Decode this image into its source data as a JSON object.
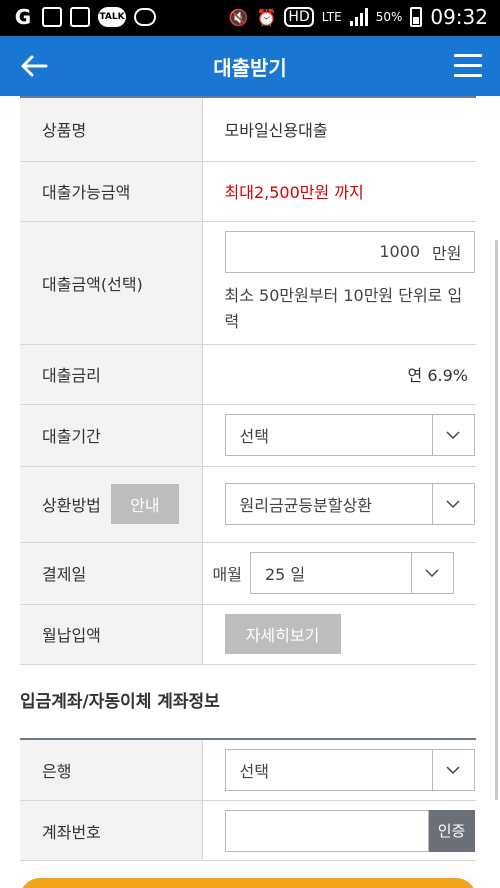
{
  "status": {
    "battery": "50%",
    "time": "09:32",
    "lte": "LTE",
    "hd": "HD",
    "talk": "TALK"
  },
  "header": {
    "title": "대출받기"
  },
  "rows": {
    "product": {
      "label": "상품명",
      "value": "모바일신용대출"
    },
    "available": {
      "label": "대출가능금액",
      "value": "최대2,500만원 까지"
    },
    "amount": {
      "label": "대출금액(선택)",
      "value": "1000",
      "unit": "만원",
      "hint": "최소 50만원부터 10만원 단위로 입력"
    },
    "rate": {
      "label": "대출금리",
      "value": "연 6.9%"
    },
    "period": {
      "label": "대출기간",
      "value": "선택"
    },
    "repay": {
      "label": "상환방법",
      "guide_btn": "안내",
      "value": "원리금균등분할상환"
    },
    "payday": {
      "label": "결제일",
      "prefix": "매월",
      "value": "25 일"
    },
    "monthly": {
      "label": "월납입액",
      "detail_btn": "자세히보기"
    }
  },
  "account_section": {
    "title": "입금계좌/자동이체 계좌정보",
    "bank": {
      "label": "은행",
      "value": "선택"
    },
    "account": {
      "label": "계좌번호",
      "value": "",
      "verify_btn": "인증"
    }
  },
  "colors": {
    "header_bg": "#1976d2",
    "accent_red": "#d20000",
    "cta": "#f2a51b"
  }
}
